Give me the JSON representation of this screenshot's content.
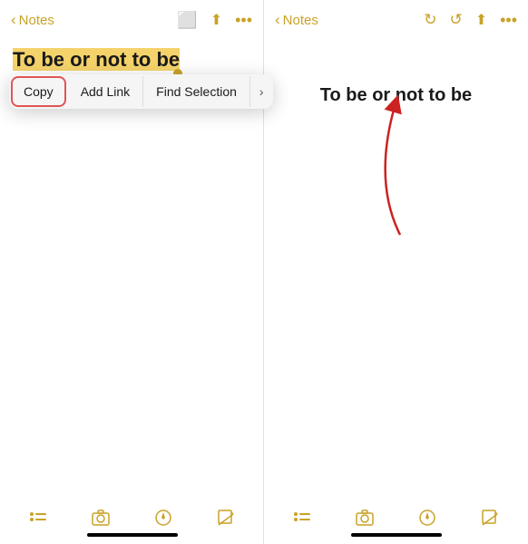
{
  "left": {
    "nav": {
      "back_label": "Notes",
      "icons": [
        "share-icon",
        "upload-icon",
        "ellipsis-icon"
      ]
    },
    "note": {
      "title": "To be or not to be"
    },
    "context_menu": {
      "copy_label": "Copy",
      "add_link_label": "Add Link",
      "find_selection_label": "Find Selection",
      "more_label": "›"
    },
    "toolbar": {
      "icons": [
        "list-icon",
        "camera-icon",
        "compose-icon",
        "edit-icon",
        "list2-icon",
        "camera2-icon",
        "compose2-icon",
        "edit2-icon"
      ]
    }
  },
  "right": {
    "nav": {
      "back_label": "Notes",
      "icons": [
        "rotate-icon",
        "refresh-icon",
        "upload-icon",
        "ellipsis-icon"
      ]
    },
    "note": {
      "title": "To be or not to be"
    }
  }
}
